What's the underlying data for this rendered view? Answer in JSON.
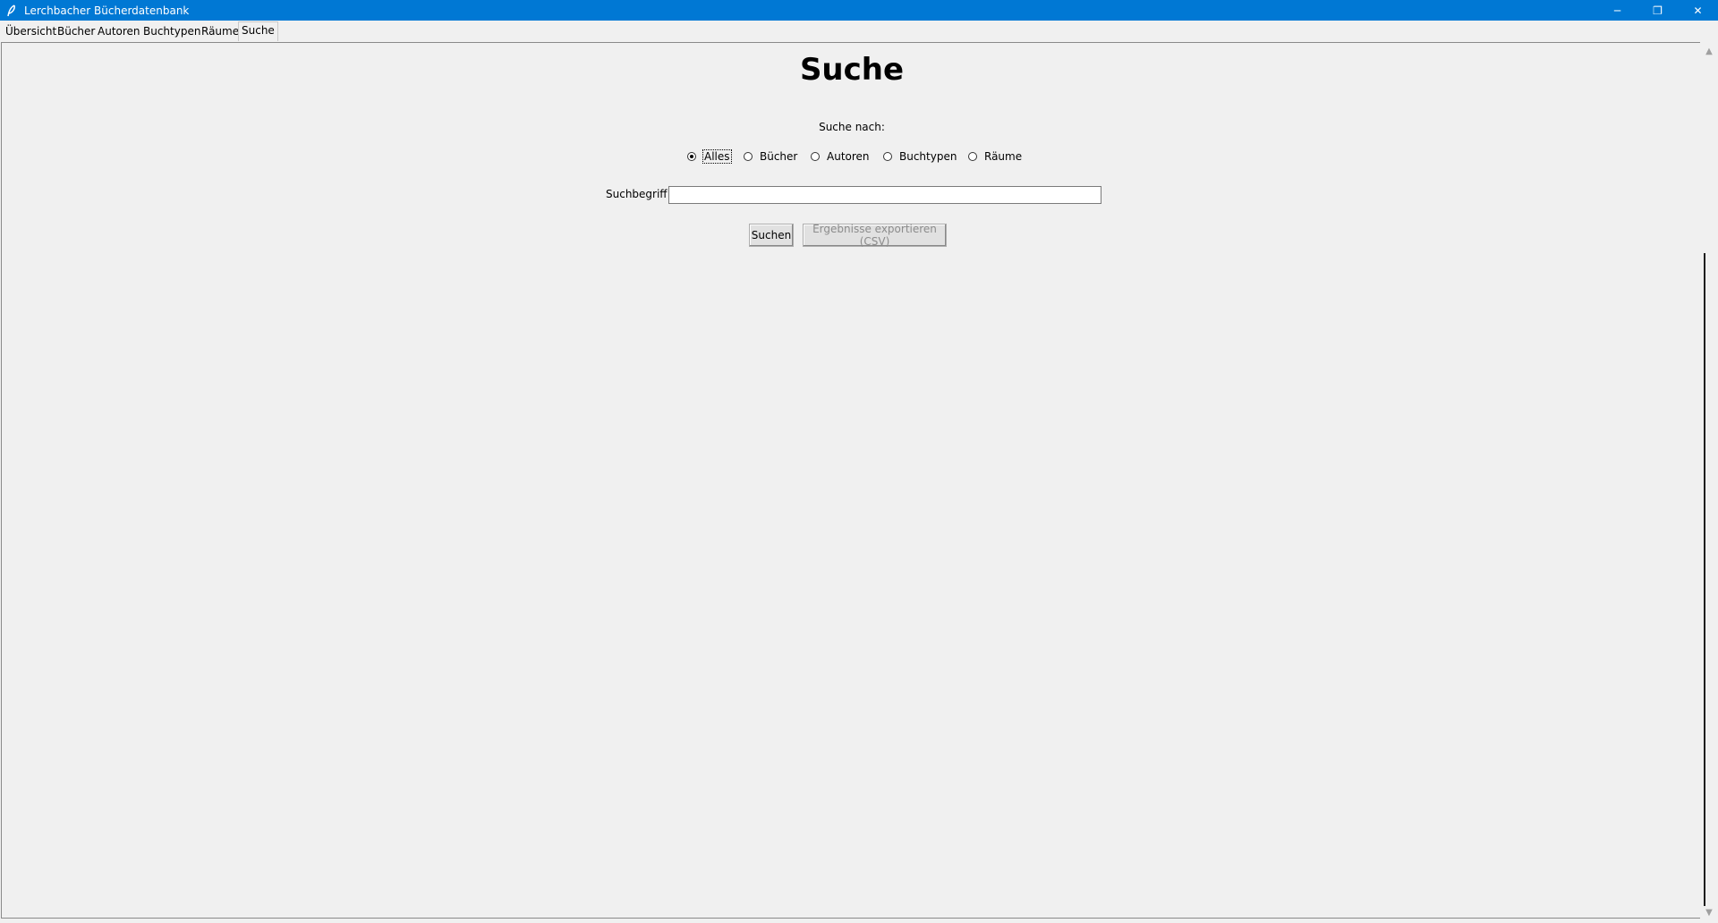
{
  "window": {
    "title": "Lerchbacher Bücherdatenbank",
    "minimize": "─",
    "maximize": "❐",
    "close": "✕"
  },
  "tabs": [
    {
      "label": "Übersicht"
    },
    {
      "label": "Bücher"
    },
    {
      "label": "Autoren"
    },
    {
      "label": "Buchtypen"
    },
    {
      "label": "Räume"
    },
    {
      "label": "Suche",
      "active": true
    }
  ],
  "page": {
    "title": "Suche",
    "search_by_label": "Suche nach:",
    "radio_options": [
      {
        "label": "Alles",
        "checked": true
      },
      {
        "label": "Bücher",
        "checked": false
      },
      {
        "label": "Autoren",
        "checked": false
      },
      {
        "label": "Buchtypen",
        "checked": false
      },
      {
        "label": "Räume",
        "checked": false
      }
    ],
    "term_label": "Suchbegriff:",
    "term_value": "",
    "search_button": "Suchen",
    "export_button": "Ergebnisse exportieren (CSV)"
  }
}
